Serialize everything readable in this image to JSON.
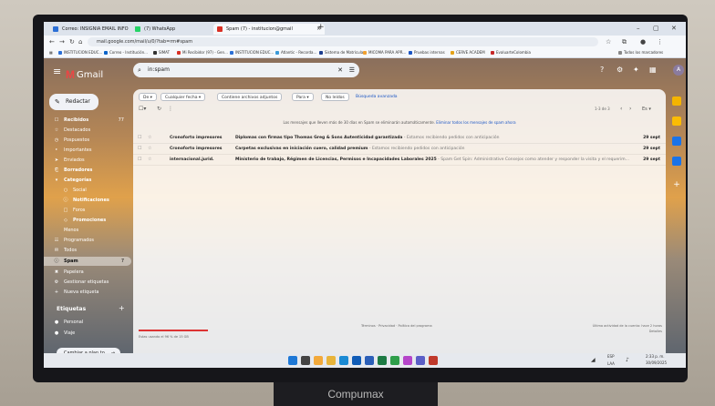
{
  "monitor_brand": "Compumax",
  "browser": {
    "tabs": [
      {
        "title": "Correo: INSIGNIA EMAIL INFO",
        "color": "#2b6fd6",
        "active": false
      },
      {
        "title": "(7) WhatsApp",
        "color": "#25d366",
        "active": false
      },
      {
        "title": "Spam (7) - institucion@gmail",
        "color": "#d93025",
        "active": true
      }
    ],
    "url": "mail.google.com/mail/u/0/?tab=rm#spam",
    "bookmarks": [
      "INSTITUCION EDUC...",
      "Correo - Institución...",
      "SIMAT",
      "Mi Recibidor (97) - Gen...",
      "INSTITUCION EDUC...",
      "Atlantic - Recorda...",
      "Sistema de Matrícula",
      "MICOMA PARA APR...",
      "Pruebas internas",
      "CERVE ACADEM",
      "EvaluarteColombia",
      "Todos los marcadores"
    ]
  },
  "gmail": {
    "logo_text": "Gmail",
    "search_value": "in:spam",
    "compose_label": "Redactar",
    "nav": [
      {
        "icon": "☐",
        "label": "Recibidos",
        "count": "77",
        "bold": true
      },
      {
        "icon": "☆",
        "label": "Destacados",
        "count": "",
        "bold": false
      },
      {
        "icon": "◷",
        "label": "Pospuestos",
        "count": "",
        "bold": false
      },
      {
        "icon": "‣",
        "label": "Importantes",
        "count": "",
        "bold": false
      },
      {
        "icon": "➤",
        "label": "Enviados",
        "count": "",
        "bold": false
      },
      {
        "icon": "⎗",
        "label": "Borradores",
        "count": "",
        "bold": true
      },
      {
        "icon": "▾",
        "label": "Categorías",
        "count": "",
        "bold": true
      },
      {
        "icon": "○",
        "label": "Social",
        "count": "",
        "bold": false
      },
      {
        "icon": "ⓘ",
        "label": "Notificaciones",
        "count": "",
        "bold": true
      },
      {
        "icon": "□",
        "label": "Foros",
        "count": "",
        "bold": false
      },
      {
        "icon": "◇",
        "label": "Promociones",
        "count": "",
        "bold": true
      },
      {
        "icon": "",
        "label": "Menos",
        "count": "",
        "bold": false
      },
      {
        "icon": "☷",
        "label": "Programados",
        "count": "",
        "bold": false
      },
      {
        "icon": "✉",
        "label": "Todos",
        "count": "",
        "bold": false
      },
      {
        "icon": "ⓘ",
        "label": "Spam",
        "count": "7",
        "bold": true,
        "selected": true
      },
      {
        "icon": "✖",
        "label": "Papelera",
        "count": "",
        "bold": false
      },
      {
        "icon": "⚙",
        "label": "Gestionar etiquetas",
        "count": "",
        "bold": false
      },
      {
        "icon": "+",
        "label": "Nueva etiqueta",
        "count": "",
        "bold": false
      }
    ],
    "labels_heading": "Etiquetas",
    "labels": [
      {
        "label": "Personal"
      },
      {
        "label": "Viaje"
      }
    ],
    "upgrade_label": "Cambiar a plan to...",
    "filters": [
      {
        "label": "De",
        "dropdown": true
      },
      {
        "label": "Cualquier fecha",
        "dropdown": true
      },
      {
        "label": "Contiene archivos adjuntos",
        "dropdown": false
      },
      {
        "label": "Para",
        "dropdown": true
      },
      {
        "label": "No leídos",
        "dropdown": false
      }
    ],
    "advanced_search": "Búsqueda avanzada",
    "pagination": "1-3 de 3",
    "spam_notice": "Los mensajes que lleven más de 30 días en Spam se eliminarán automáticamente.",
    "spam_notice_link": "Eliminar todos los mensajes de spam ahora",
    "emails": [
      {
        "sender": "Cronoforto impresores",
        "subject": "Diplomas con firmas tipo Thomas Greg & Sons Autenticidad garantizada",
        "snippet": " - Estamos recibiendo pedidos con anticipación",
        "date": "29 sept"
      },
      {
        "sender": "Cronoforto impresores",
        "subject": "Carpetas exclusivas en iniciación cuero, calidad premium",
        "snippet": " - Estamos recibiendo pedidos con anticipación",
        "date": "29 sept"
      },
      {
        "sender": "internacional.jurid.",
        "subject": "Ministerio de trabajo, Régimen de Licencias, Permisos e Incapacidades Laborales 2025",
        "snippet": " - Spam Get Spin: Administrative Consejos como atender y responder la visita y el requerim...",
        "date": "29 sept"
      }
    ],
    "storage_text": "Estas usando el 96 % de 15 GB",
    "footer_center": "Términos · Privacidad · Política del programa",
    "footer_right": "Última actividad de la cuenta: hace 2 horas",
    "footer_right2": "Detalles"
  },
  "taskbar": {
    "icons": [
      {
        "name": "windows-icon",
        "color": "#1e78d6"
      },
      {
        "name": "search-icon",
        "color": "#444444"
      },
      {
        "name": "widgets-icon",
        "color": "#f2a93b"
      },
      {
        "name": "file-explorer-icon",
        "color": "#e8b43a"
      },
      {
        "name": "edge-icon",
        "color": "#1a8ad4"
      },
      {
        "name": "outlook-icon",
        "color": "#0f5cb7"
      },
      {
        "name": "word-icon",
        "color": "#2b5fb8"
      },
      {
        "name": "excel-icon",
        "color": "#1d7a44"
      },
      {
        "name": "chrome-icon",
        "color": "#2e9e4a"
      },
      {
        "name": "photos-icon",
        "color": "#b545c9"
      },
      {
        "name": "teams-icon",
        "color": "#5b5fc7"
      },
      {
        "name": "store-icon",
        "color": "#c0392b"
      }
    ],
    "lang": "ESP\nLAA",
    "time": "2:33 p. m.",
    "date": "30/09/2025"
  }
}
